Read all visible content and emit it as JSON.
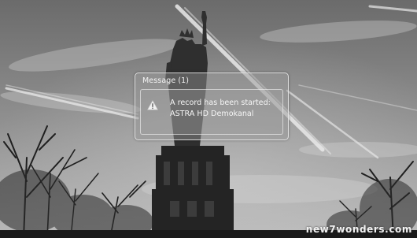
{
  "message_popup": {
    "title": "Message",
    "count": "(1)",
    "icon": "warning-triangle-icon",
    "line1": "A record has been started:",
    "line2": "ASTRA HD Demokanal"
  },
  "watermark": "new7wonders.com"
}
